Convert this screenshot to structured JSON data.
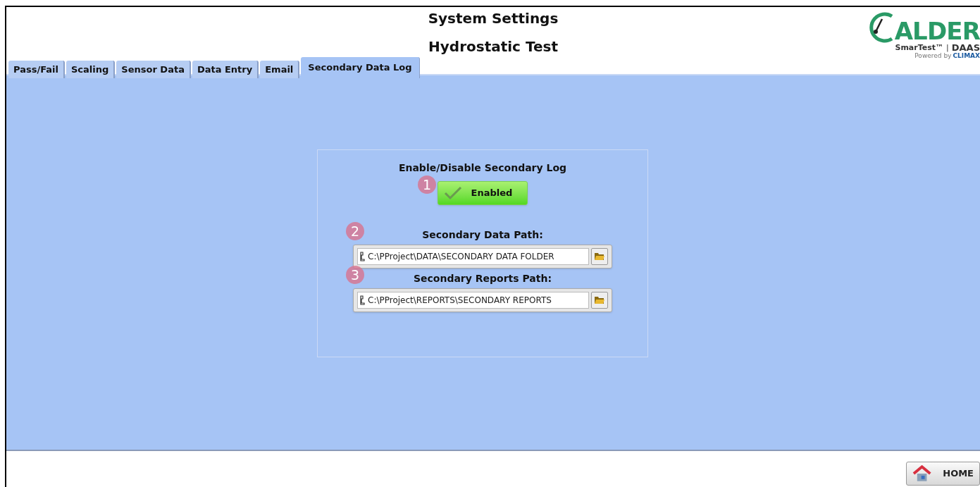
{
  "header": {
    "title": "System Settings",
    "subtitle": "Hydrostatic Test"
  },
  "logo": {
    "wordmark": "ALDER",
    "product": "SmarTest™",
    "separator": "|",
    "suite": "DAAS",
    "powered_by": "Powered by",
    "brand": "CLIMAX"
  },
  "tabs": [
    {
      "label": "Pass/Fail",
      "selected": false
    },
    {
      "label": "Scaling",
      "selected": false
    },
    {
      "label": "Sensor Data",
      "selected": false
    },
    {
      "label": "Data Entry",
      "selected": false
    },
    {
      "label": "Email",
      "selected": false
    },
    {
      "label": "Secondary Data Log",
      "selected": true
    }
  ],
  "panel": {
    "toggle_label": "Enable/Disable Secondary Log",
    "toggle": {
      "label": "Enabled",
      "on": true,
      "callout": "1"
    },
    "paths": [
      {
        "label": "Secondary Data Path:",
        "value": "C:\\PProject\\DATA\\SECONDARY DATA FOLDER",
        "callout": "2"
      },
      {
        "label": "Secondary Reports Path:",
        "value": "C:\\PProject\\REPORTS\\SECONDARY REPORTS",
        "callout": "3"
      }
    ]
  },
  "footer": {
    "home_button": "HOME"
  }
}
